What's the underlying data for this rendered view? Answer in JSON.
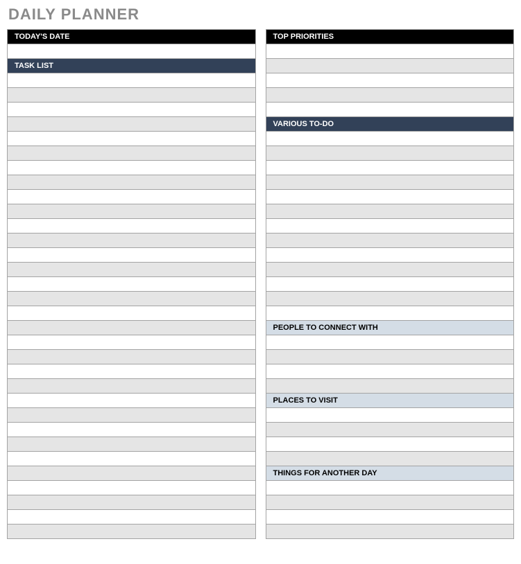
{
  "title": "DAILY PLANNER",
  "left": {
    "todays_date": "TODAY'S DATE",
    "task_list": "TASK LIST"
  },
  "right": {
    "top_priorities": "TOP PRIORITIES",
    "various_todo": "VARIOUS TO-DO",
    "people_to_connect": "PEOPLE TO CONNECT WITH",
    "places_to_visit": "PLACES TO VISIT",
    "things_another_day": "THINGS FOR ANOTHER DAY"
  }
}
